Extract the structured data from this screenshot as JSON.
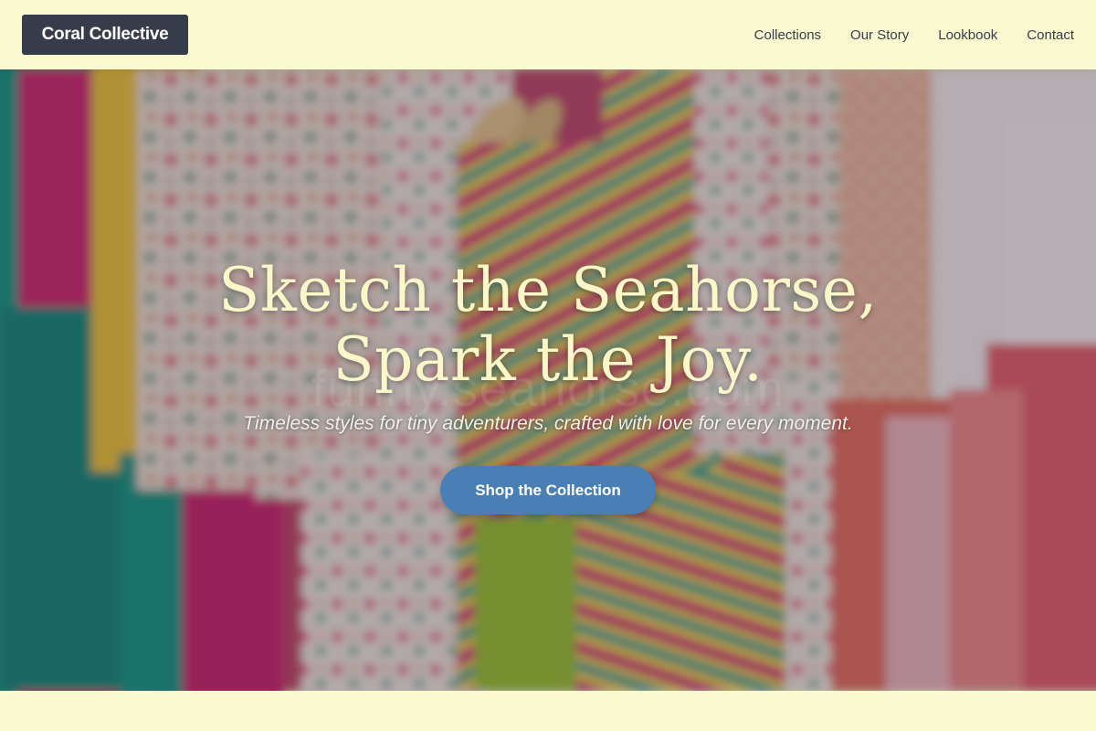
{
  "header": {
    "brand": "Coral Collective",
    "nav": [
      {
        "label": "Collections"
      },
      {
        "label": "Our Story"
      },
      {
        "label": "Lookbook"
      },
      {
        "label": "Contact"
      }
    ]
  },
  "hero": {
    "title_line1": "Sketch the Seahorse,",
    "title_line2": "Spark the Joy.",
    "subtitle": "Timeless styles for tiny adventurers, crafted with love for every moment.",
    "cta": "Shop the Collection",
    "watermark": "funny.seahorse.com",
    "background_icon": "clothing-rack-photo"
  },
  "colors": {
    "page_bg": "#fbf9cf",
    "brand_bg": "#363c4a",
    "title": "#fbf7c9",
    "cta_bg": "#4a7fb5"
  }
}
